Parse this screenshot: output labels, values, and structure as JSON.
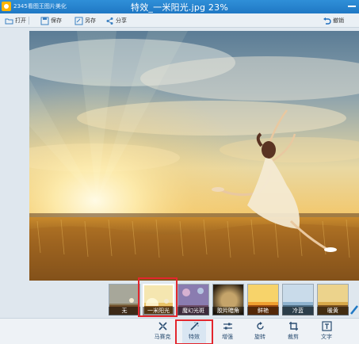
{
  "window": {
    "app_name": "2345看图王图片美化",
    "doc_title": "特效_一米阳光.jpg 23%"
  },
  "toolbar": {
    "open_label": "打开",
    "save_label": "保存",
    "save_as_label": "另存",
    "share_label": "分享",
    "undo_label": "撤销"
  },
  "filmstrip": {
    "items": [
      {
        "label": "无",
        "tone": "plain"
      },
      {
        "label": "一米阳光",
        "tone": "warm",
        "selected": true
      },
      {
        "label": "魔幻光斑",
        "tone": "magic"
      },
      {
        "label": "胶片暗角",
        "tone": "vignette"
      },
      {
        "label": "鲜艳",
        "tone": "vivid"
      },
      {
        "label": "冷蓝",
        "tone": "cold"
      },
      {
        "label": "暖黄",
        "tone": "yellow"
      }
    ]
  },
  "bottombar": {
    "mosaic_label": "马赛克",
    "effects_label": "特效",
    "enhance_label": "增强",
    "rotate_label": "旋转",
    "crop_label": "裁剪",
    "text_label": "文字"
  },
  "colors": {
    "titlebar": "#1f78c4",
    "highlight": "#e3262d",
    "accent_text": "#2b4e72"
  },
  "icons": [
    "app-logo-icon",
    "open-icon",
    "save-icon",
    "save-as-icon",
    "share-icon",
    "undo-icon",
    "minimize-icon",
    "mosaic-icon",
    "magic-wand-icon",
    "enhance-icon",
    "rotate-icon",
    "crop-icon",
    "text-icon"
  ]
}
